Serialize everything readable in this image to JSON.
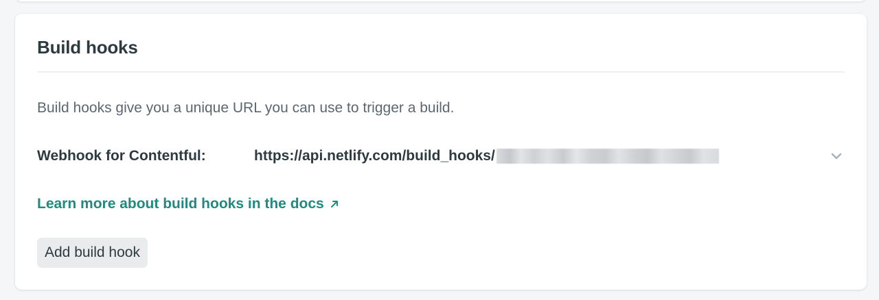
{
  "section": {
    "title": "Build hooks",
    "description": "Build hooks give you a unique URL you can use to trigger a build."
  },
  "hook": {
    "label": "Webhook for Contentful:",
    "url_prefix": "https://api.netlify.com/build_hooks/",
    "expand_icon": "chevron-down-icon"
  },
  "docs_link": {
    "label": "Learn more about build hooks in the docs",
    "icon": "arrow-up-right-icon",
    "color": "#1f8a7e"
  },
  "actions": {
    "add_label": "Add build hook"
  }
}
